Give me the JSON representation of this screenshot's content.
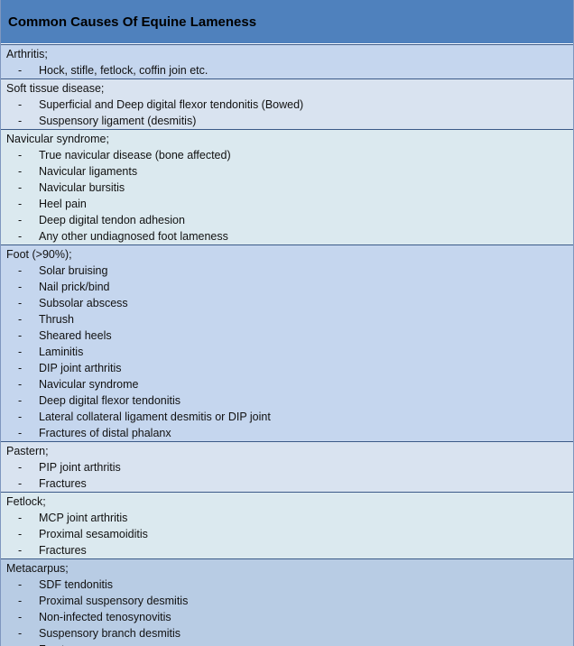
{
  "title": "Common Causes Of Equine Lameness",
  "bullet": "-",
  "sections": [
    {
      "heading": "Arthritis;",
      "items": [
        "Hock, stifle, fetlock, coffin join etc."
      ]
    },
    {
      "heading": "Soft tissue disease;",
      "items": [
        "Superficial and Deep digital flexor tendonitis (Bowed)",
        "Suspensory ligament (desmitis)"
      ]
    },
    {
      "heading": "Navicular syndrome;",
      "items": [
        "True navicular disease (bone affected)",
        "Navicular ligaments",
        "Navicular bursitis",
        "Heel pain",
        "Deep digital tendon adhesion",
        "Any other undiagnosed foot lameness"
      ]
    },
    {
      "heading": "Foot (>90%);",
      "items": [
        "Solar bruising",
        "Nail prick/bind",
        "Subsolar abscess",
        "Thrush",
        "Sheared heels",
        "Laminitis",
        "DIP joint arthritis",
        "Navicular syndrome",
        "Deep digital flexor tendonitis",
        "Lateral collateral ligament desmitis or DIP joint",
        "Fractures of distal phalanx"
      ]
    },
    {
      "heading": "Pastern;",
      "items": [
        "PIP joint arthritis",
        "Fractures"
      ]
    },
    {
      "heading": "Fetlock;",
      "items": [
        "MCP joint arthritis",
        "Proximal sesamoiditis",
        "Fractures"
      ]
    },
    {
      "heading": "Metacarpus;",
      "items": [
        "SDF tendonitis",
        "Proximal suspensory desmitis",
        "Non-infected tenosynovitis",
        "Suspensory branch desmitis",
        "Fractures"
      ]
    }
  ]
}
